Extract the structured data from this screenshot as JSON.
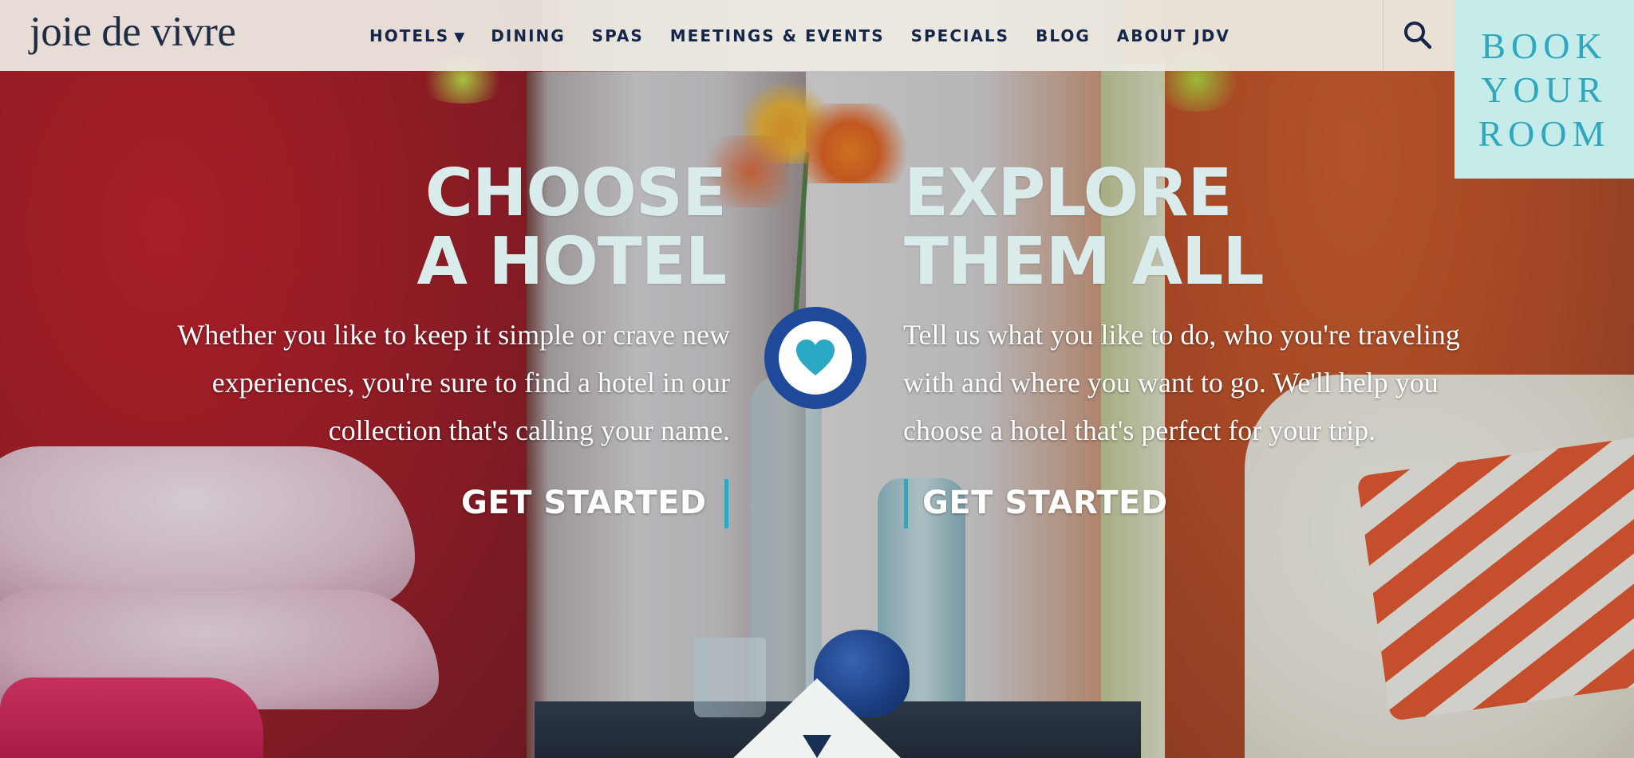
{
  "header": {
    "logo": "joie de vivre",
    "nav": [
      {
        "label": "HOTELS",
        "has_dropdown": true
      },
      {
        "label": "DINING"
      },
      {
        "label": "SPAS"
      },
      {
        "label": "MEETINGS & EVENTS"
      },
      {
        "label": "SPECIALS"
      },
      {
        "label": "BLOG"
      },
      {
        "label": "ABOUT JDV"
      }
    ],
    "dropdown_caret": "▼",
    "search_icon": "search-icon",
    "book": {
      "line1": "BOOK",
      "line2": "YOUR",
      "line3": "ROOM"
    }
  },
  "hero": {
    "left": {
      "heading_line1": "CHOOSE",
      "heading_line2": "A HOTEL",
      "text": "Whether you like to keep it simple or crave new experiences, you're sure to find a hotel in our collection that's calling your name.",
      "cta": "GET STARTED"
    },
    "right": {
      "heading_line1": "EXPLORE",
      "heading_line2": "THEM ALL",
      "text": "Tell us what you like to do, who you're traveling with and where you want to go. We'll help you choose a hotel that's perfect for your trip.",
      "cta": "GET STARTED"
    },
    "center_icon": "heart-icon",
    "scroll_icon": "scroll-down-icon"
  },
  "colors": {
    "nav_text": "#16264a",
    "book_bg": "#c6ecea",
    "book_text": "#31a7bd",
    "accent_bar": "#2aa8c4",
    "heart": "#2aa8c4",
    "heart_ring": "#1f4a9c",
    "heading": "#d9ebea"
  }
}
